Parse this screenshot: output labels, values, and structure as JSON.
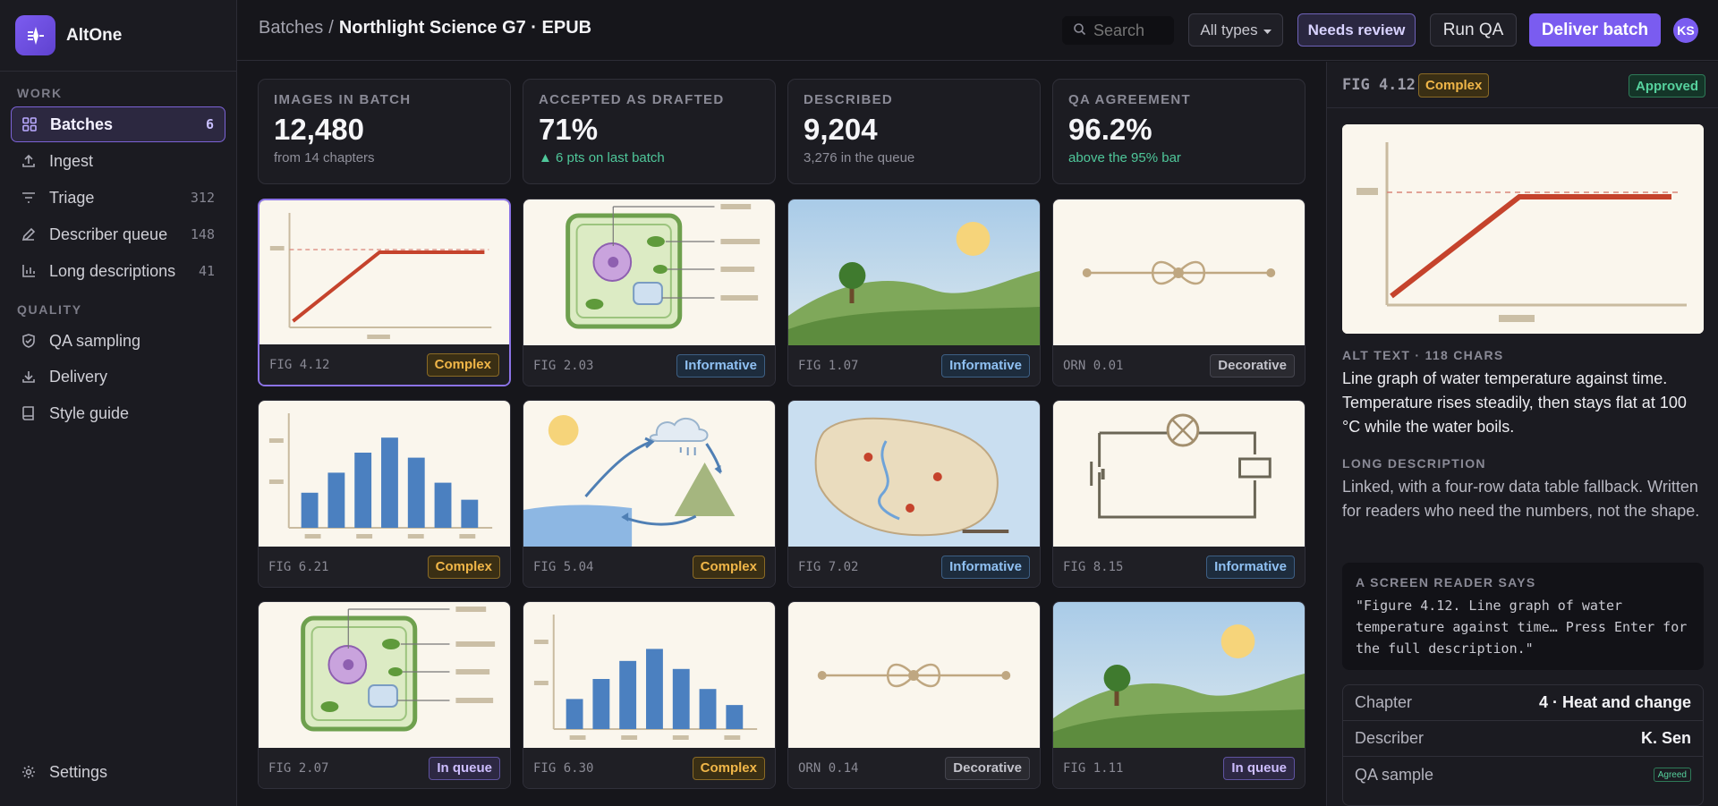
{
  "app": {
    "name": "AltOne"
  },
  "sidebar": {
    "sections": [
      {
        "label": "WORK"
      },
      {
        "label": "QUALITY"
      }
    ],
    "items": [
      {
        "label": "Batches",
        "count": "6"
      },
      {
        "label": "Ingest",
        "count": ""
      },
      {
        "label": "Triage",
        "count": "312"
      },
      {
        "label": "Describer queue",
        "count": "148"
      },
      {
        "label": "Long descriptions",
        "count": "41"
      },
      {
        "label": "QA sampling",
        "count": ""
      },
      {
        "label": "Delivery",
        "count": ""
      },
      {
        "label": "Style guide",
        "count": ""
      },
      {
        "label": "Settings",
        "count": ""
      }
    ],
    "icons": [
      "grid-icon",
      "upload-icon",
      "filter-icon",
      "pencil-icon",
      "bar-chart-icon",
      "shield-check-icon",
      "download-icon",
      "book-icon",
      "gear-icon"
    ]
  },
  "header": {
    "crumb_root": "Batches",
    "crumb_sep": "/",
    "crumb_current": "Northlight Science G7 · EPUB",
    "search_placeholder": "Search",
    "types_label": "All types",
    "review_label": "Needs review",
    "runqa_label": "Run QA",
    "deliver_label": "Deliver batch",
    "avatar_initials": "KS"
  },
  "stats": [
    {
      "label": "IMAGES IN BATCH",
      "value": "12,480",
      "sub": "from 14 chapters"
    },
    {
      "label": "ACCEPTED AS DRAFTED",
      "value": "71%",
      "sub": "▲ 6 pts on last batch"
    },
    {
      "label": "DESCRIBED",
      "value": "9,204",
      "sub": "3,276 in the queue"
    },
    {
      "label": "QA AGREEMENT",
      "value": "96.2%",
      "sub": "above the 95% bar"
    }
  ],
  "cards": [
    {
      "id": "FIG 4.12",
      "badge": "Complex",
      "kind": "line"
    },
    {
      "id": "FIG 2.03",
      "badge": "Informative",
      "kind": "cell"
    },
    {
      "id": "FIG 1.07",
      "badge": "Informative",
      "kind": "landscape"
    },
    {
      "id": "ORN 0.01",
      "badge": "Decorative",
      "kind": "ornament"
    },
    {
      "id": "FIG 6.21",
      "badge": "Complex",
      "kind": "bars"
    },
    {
      "id": "FIG 5.04",
      "badge": "Complex",
      "kind": "water"
    },
    {
      "id": "FIG 7.02",
      "badge": "Informative",
      "kind": "map"
    },
    {
      "id": "FIG 8.15",
      "badge": "Informative",
      "kind": "circuit"
    },
    {
      "id": "FIG 2.07",
      "badge": "In queue",
      "kind": "cell"
    },
    {
      "id": "FIG 6.30",
      "badge": "Complex",
      "kind": "bars"
    },
    {
      "id": "ORN 0.14",
      "badge": "Decorative",
      "kind": "ornament"
    },
    {
      "id": "FIG 1.11",
      "badge": "In queue",
      "kind": "landscape"
    }
  ],
  "detail": {
    "fig": "FIG 4.12",
    "badge": "Complex",
    "status": "Approved",
    "alt_label": "ALT TEXT · 118 CHARS",
    "alt_text": "Line graph of water temperature against time. Temperature rises steadily, then stays flat at 100 °C while the water boils.",
    "long_label": "LONG DESCRIPTION",
    "long_text": "Linked, with a four-row data table fallback. Written for readers who need the numbers, not the shape.",
    "sr_label": "A SCREEN READER SAYS",
    "sr_text": "\"Figure 4.12. Line graph of water temperature against time… Press Enter for the full description.\"",
    "meta": [
      {
        "key": "Chapter",
        "value": "4 · Heat and change"
      },
      {
        "key": "Describer",
        "value": "K. Sen"
      },
      {
        "key": "QA sample",
        "value": "Agreed"
      }
    ]
  },
  "colors": {
    "accent": "#7a5cf0",
    "complex": "#f0b648",
    "informative": "#8fc0f2",
    "approved": "#56d19d"
  }
}
